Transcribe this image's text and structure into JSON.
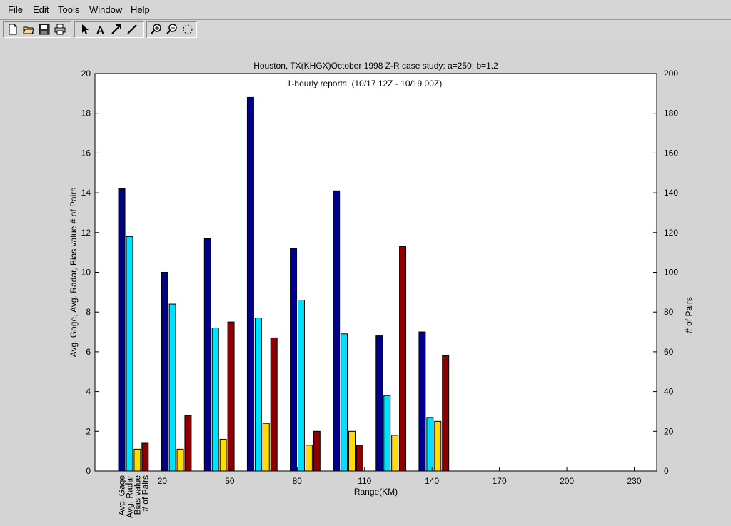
{
  "menu": {
    "file": "File",
    "edit": "Edit",
    "tools": "Tools",
    "window": "Window",
    "help": "Help"
  },
  "toolbar": {
    "buttons": [
      "new-file-icon",
      "open-folder-icon",
      "save-icon",
      "print-icon",
      "select-arrow-icon",
      "text-tool-icon",
      "arrow-tool-icon",
      "line-tool-icon",
      "zoom-in-icon",
      "zoom-out-icon",
      "rotate-icon"
    ]
  },
  "chart_data": {
    "type": "bar",
    "title": "Houston, TX(KHGX)October 1998 Z-R case study: a=250; b=1.2",
    "subtitle": "1-hourly reports: (10/17 12Z - 10/19 00Z)",
    "xlabel": "Range(KM)",
    "ylabel": "Avg. Gage, Avg. Radar, Bias value  # of Pairs",
    "y2label": "# of Pairs",
    "xlim": [
      -10,
      240
    ],
    "ylim": [
      0,
      20
    ],
    "y2lim": [
      0,
      200
    ],
    "x_ticks": [
      20,
      50,
      80,
      110,
      140,
      170,
      200,
      230
    ],
    "y_ticks": [
      0,
      2,
      4,
      6,
      8,
      10,
      12,
      14,
      16,
      18,
      20
    ],
    "y2_ticks": [
      0,
      20,
      40,
      60,
      80,
      100,
      120,
      140,
      160,
      180,
      200
    ],
    "bar_labels": [
      "Avg. Gage",
      "Avg. Radar",
      "Bias value",
      "# of Pairs"
    ],
    "groups": [
      0,
      1,
      2,
      3,
      4,
      5,
      6,
      7
    ],
    "series": [
      {
        "values": [
          14.2,
          10.0,
          11.7,
          18.8,
          11.2,
          14.1,
          6.8,
          7.0
        ],
        "color": "#00008b"
      },
      {
        "values": [
          11.8,
          8.4,
          7.2,
          7.7,
          8.6,
          6.9,
          3.8,
          2.7
        ],
        "color": "#00e0ff"
      },
      {
        "values": [
          1.1,
          1.1,
          1.6,
          2.4,
          1.3,
          2.0,
          1.8,
          2.5
        ],
        "color": "#ffdd00"
      },
      {
        "values": [
          14,
          28,
          75,
          67,
          20,
          13,
          113,
          58
        ],
        "color": "#8b0000",
        "axis": "right"
      }
    ]
  }
}
